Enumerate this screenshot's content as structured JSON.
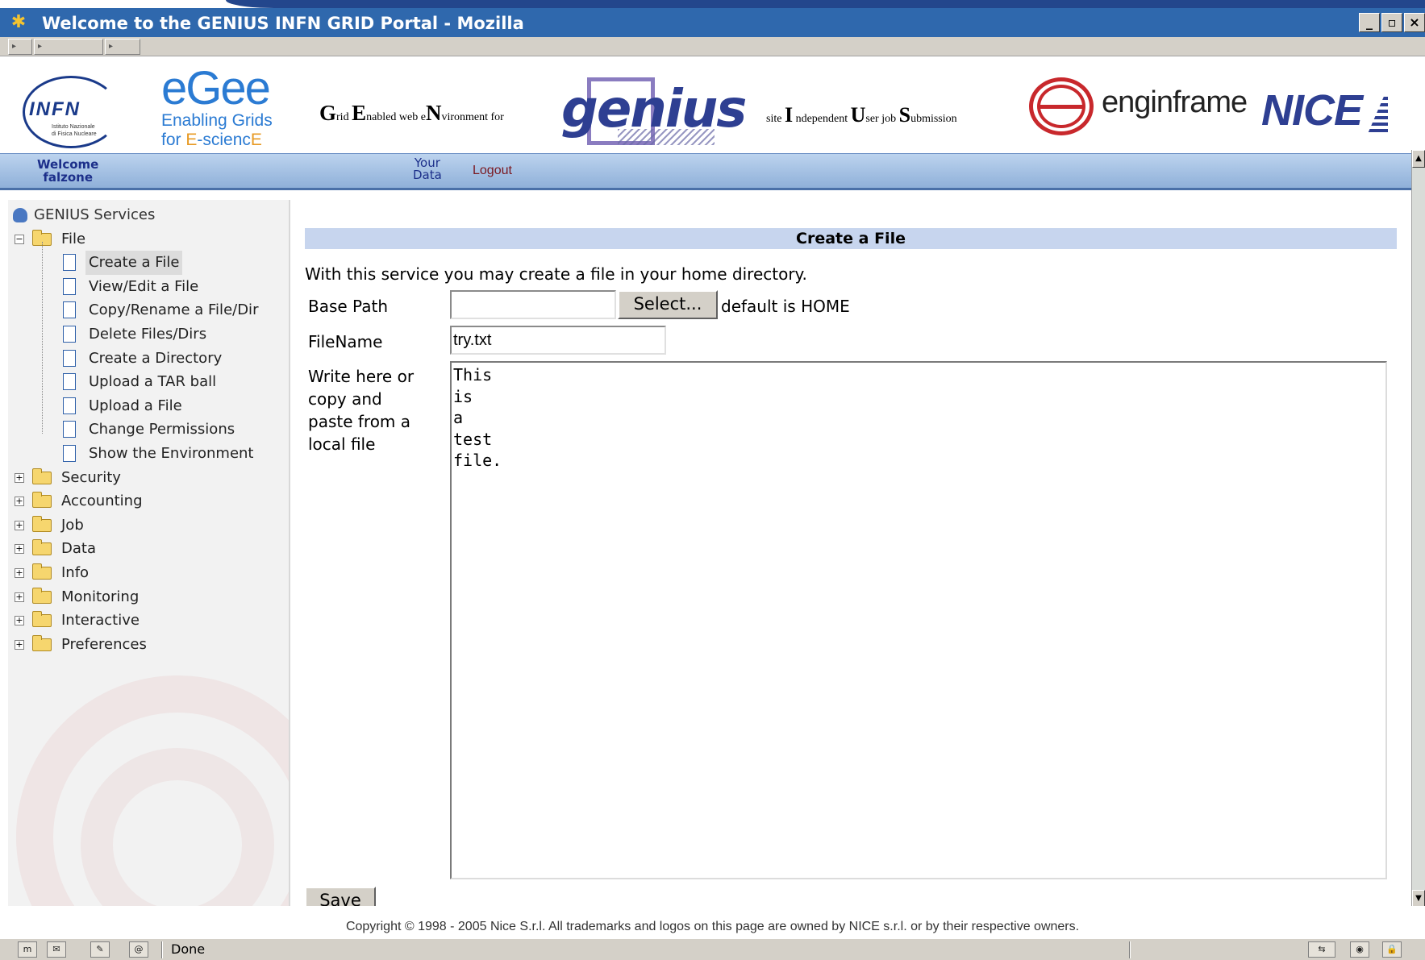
{
  "window": {
    "title": "Welcome to the GENIUS INFN GRID Portal - Mozilla",
    "buttons": [
      "_",
      "▫",
      "×"
    ]
  },
  "header": {
    "infn_logo": {
      "text": "INFN",
      "line1": "Istituto Nazionale",
      "line2": "di Fisica Nucleare"
    },
    "egee_logo": {
      "word": "eGee",
      "line1": "Enabling Grids",
      "line2_prefix": "for ",
      "line2_e": "E",
      "line2_mid": "-scienc",
      "line2_end": "E"
    },
    "genius_tag": {
      "g": "G",
      "g_rest": "rid ",
      "e": "E",
      "e_rest": "nabled web e",
      "n": "N",
      "n_rest": "vironment for"
    },
    "genius_logo": "genius",
    "site_tag": {
      "s_rest": "site ",
      "i": "I",
      "i_rest": " ndependent ",
      "u": "U",
      "u_rest": "ser job ",
      "sub": "S",
      "sub_rest": "ubmission"
    },
    "enginframe_logo": "enginframe",
    "nice_logo": "NICE"
  },
  "topbar": {
    "welcome_line1": "Welcome",
    "welcome_line2": "falzone",
    "your_data_line1": "Your",
    "your_data_line2": "Data",
    "logout": "Logout"
  },
  "sidebar": {
    "root_label": "GENIUS Services",
    "file_folder": "File",
    "file_items": [
      "Create a File",
      "View/Edit a File",
      "Copy/Rename a File/Dir",
      "Delete Files/Dirs",
      "Create a Directory",
      "Upload a TAR ball",
      "Upload a File",
      "Change Permissions",
      "Show the Environment"
    ],
    "folders": [
      "Security",
      "Accounting",
      "Job",
      "Data",
      "Info",
      "Monitoring",
      "Interactive",
      "Preferences"
    ],
    "expander_open": "−",
    "expander_closed": "+"
  },
  "main": {
    "section_title": "Create a File",
    "intro": "With this service you may create a file in your home directory.",
    "base_path_label": "Base Path",
    "base_path_value": "",
    "select_button": "Select...",
    "default_note": "default is HOME",
    "filename_label": "FileName",
    "filename_value": "try.txt",
    "write_label_lines": [
      "Write here or",
      "copy and",
      "paste from a",
      "local file"
    ],
    "textarea_lines": [
      "This",
      "is",
      "a",
      "test",
      "file."
    ],
    "save_button": "Save"
  },
  "footer": {
    "copyright": "Copyright © 1998 - 2005 Nice S.r.l. All trademarks and logos on this page are owned by NICE s.r.l. or by their respective owners."
  },
  "statusbar": {
    "status_text": "Done"
  },
  "icons": {
    "app": "mozilla-icon",
    "tree_root": "genius-services-icon",
    "folder": "folder-icon",
    "doc": "document-icon"
  }
}
